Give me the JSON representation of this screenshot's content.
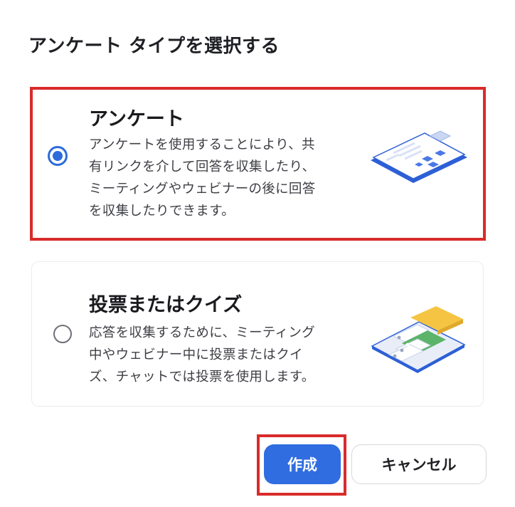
{
  "dialog": {
    "title": "アンケート タイプを選択する"
  },
  "options": [
    {
      "title": "アンケート",
      "description": "アンケートを使用することにより、共\n有リンクを介して回答を収集したり、\nミーティングやウェビナーの後に回答\nを収集したりできます。",
      "selected": true,
      "illustration": "survey-clipboard-illustration"
    },
    {
      "title": "投票またはクイズ",
      "description": "応答を収集するために、ミーティング\n中やウェビナー中に投票またはクイ\nズ、チャットでは投票を使用します。",
      "selected": false,
      "illustration": "poll-quiz-illustration"
    }
  ],
  "buttons": {
    "create_label": "作成",
    "cancel_label": "キャンセル"
  },
  "colors": {
    "accent": "#2f6de0",
    "highlight": "#d92b2b",
    "quiz_yellow": "#f5c443",
    "quiz_green": "#5bb46a"
  }
}
